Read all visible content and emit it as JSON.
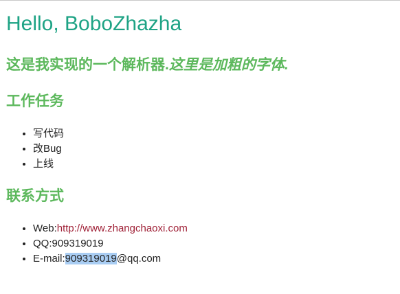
{
  "page": {
    "title": "Hello, BoboZhazha",
    "intro": {
      "text": "这是我实现的一个解析器.",
      "bold_italic": "这里是加粗的字体",
      "suffix": "."
    }
  },
  "tasks": {
    "heading": "工作任务",
    "items": [
      "写代码",
      "改Bug",
      "上线"
    ]
  },
  "contact": {
    "heading": "联系方式",
    "web_label": "Web:",
    "web_url": "http://www.zhangchaoxi.com",
    "qq": "QQ:909319019",
    "email_label": "E-mail:",
    "email_selected": "909319019",
    "email_domain": "@qq.com"
  },
  "colors": {
    "title": "#1ea385",
    "headings": "#5cb85c",
    "link": "#a02238",
    "selection": "#a9cdf3"
  }
}
